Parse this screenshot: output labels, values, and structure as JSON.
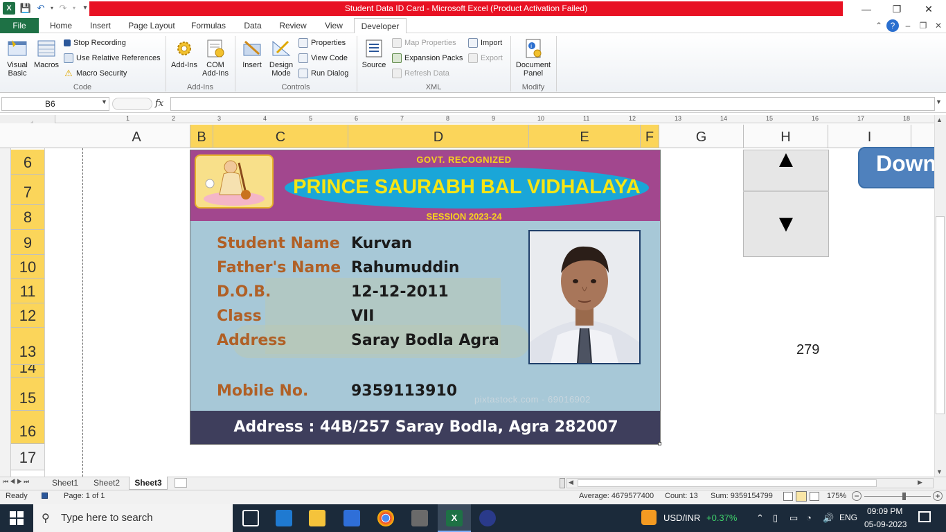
{
  "window": {
    "title": "Student Data ID Card  -  Microsoft Excel (Product Activation Failed)",
    "minimize": "—",
    "restore": "❐",
    "close": "✕"
  },
  "ribbon_tabs": [
    "File",
    "Home",
    "Insert",
    "Page Layout",
    "Formulas",
    "Data",
    "Review",
    "View",
    "Developer"
  ],
  "ribbon": {
    "code": {
      "label": "Code",
      "visual_basic": "Visual\nBasic",
      "macros": "Macros",
      "stop_recording": "Stop Recording",
      "relative_refs": "Use Relative References",
      "macro_security": "Macro Security"
    },
    "addins": {
      "label": "Add-Ins",
      "addins": "Add-Ins",
      "com_addins": "COM\nAdd-Ins"
    },
    "controls": {
      "label": "Controls",
      "insert": "Insert",
      "design_mode": "Design\nMode",
      "properties": "Properties",
      "view_code": "View Code",
      "run_dialog": "Run Dialog"
    },
    "xml": {
      "label": "XML",
      "source": "Source",
      "map_properties": "Map Properties",
      "expansion_packs": "Expansion Packs",
      "refresh_data": "Refresh Data",
      "import": "Import",
      "export": "Export"
    },
    "modify": {
      "label": "Modify",
      "document_panel": "Document\nPanel"
    }
  },
  "formula_bar": {
    "name_box": "B6",
    "fx": "fx",
    "value": ""
  },
  "columns": [
    "A",
    "B",
    "C",
    "D",
    "E",
    "F",
    "G",
    "H",
    "I"
  ],
  "rows": [
    "6",
    "7",
    "8",
    "9",
    "10",
    "11",
    "12",
    "13",
    "14",
    "15",
    "16",
    "17"
  ],
  "ruler_numbers": [
    "1",
    "2",
    "3",
    "4",
    "5",
    "6",
    "7",
    "8",
    "9",
    "10",
    "11",
    "12",
    "13",
    "14",
    "15",
    "16",
    "17",
    "18"
  ],
  "card": {
    "govt": "GOVT. RECOGNIZED",
    "school_name": "PRINCE SAURABH BAL VIDHALAYA",
    "session": "SESSION 2023-24",
    "fields": [
      {
        "label": "Student Name",
        "value": "Kurvan"
      },
      {
        "label": "Father's Name",
        "value": "Rahumuddin"
      },
      {
        "label": "D.O.B.",
        "value": "12-12-2011"
      },
      {
        "label": "Class",
        "value": "VII"
      },
      {
        "label": "Address",
        "value": "Saray Bodla Agra"
      },
      {
        "label": "Mobile No.",
        "value": "9359113910"
      }
    ],
    "watermark": "pixtastock.com - 69016902",
    "footer": "Address  :  44B/257 Saray Bodla, Agra 282007"
  },
  "spin_up": "▲",
  "spin_down": "▼",
  "download_button": "Down",
  "cell_value": "279",
  "sheets": [
    "Sheet1",
    "Sheet2",
    "Sheet3"
  ],
  "status": {
    "ready": "Ready",
    "page": "Page: 1 of 1",
    "average": "Average: 4679577400",
    "count": "Count: 13",
    "sum": "Sum: 9359154799",
    "zoom": "175%"
  },
  "taskbar": {
    "search_placeholder": "Type here to search",
    "currency": "USD/INR",
    "currency_change": "+0.37%",
    "language": "ENG",
    "time": "09:09 PM",
    "date": "05-09-2023"
  },
  "colors": {
    "excel_green": "#1e7145",
    "title_red": "#e81123",
    "selected_header": "#fbd55a",
    "card_header": "#a2478e",
    "school_oval": "#1aa6d8",
    "school_text": "#f5e514",
    "label_brown": "#b06026",
    "footer_bg": "#3e3e5c"
  }
}
